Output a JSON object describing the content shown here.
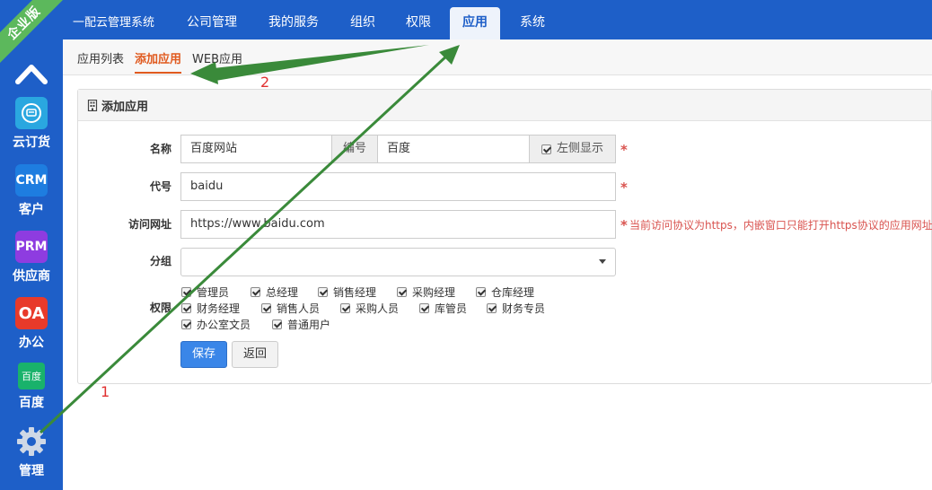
{
  "sidebar": {
    "ribbon": "企业版",
    "items": [
      {
        "label": "云订货",
        "tile_text": "",
        "color": "#2aa7e0"
      },
      {
        "label": "客户",
        "tile_text": "CRM",
        "color": "#1e7de0"
      },
      {
        "label": "供应商",
        "tile_text": "PRM",
        "color": "#8e3ce0"
      },
      {
        "label": "办公",
        "tile_text": "OA",
        "color": "#e83a2a"
      },
      {
        "label": "百度",
        "tile_text": "百度",
        "color": "#19b26b"
      },
      {
        "label": "管理",
        "tile_text": "",
        "color": "#1e5fc8"
      }
    ]
  },
  "topnav": {
    "brand": "一配云管理系统",
    "items": [
      "公司管理",
      "我的服务",
      "组织",
      "权限",
      "应用",
      "系统"
    ],
    "active": "应用"
  },
  "subtabs": [
    "应用列表",
    "添加应用",
    "WEB应用"
  ],
  "panel": {
    "title": "添加应用",
    "name_label": "名称",
    "name_value": "百度网站",
    "number_label": "编号",
    "number_value": "百度",
    "left_show_label": "左侧显示",
    "code_label": "代号",
    "code_value": "baidu",
    "url_label": "访问网址",
    "url_value": "https://www.baidu.com",
    "url_hint": "当前访问协议为https，内嵌窗口只能打开https协议的应用网址。",
    "group_label": "分组",
    "group_value": "",
    "perm_label": "权限",
    "permissions": [
      "管理员",
      "总经理",
      "销售经理",
      "采购经理",
      "仓库经理",
      "财务经理",
      "销售人员",
      "采购人员",
      "库管员",
      "财务专员",
      "办公室文员",
      "普通用户"
    ],
    "save_label": "保存",
    "back_label": "返回",
    "required_mark": "*"
  },
  "annotations": {
    "one": "1",
    "two": "2"
  },
  "colors": {
    "brand_blue": "#1e5fc8",
    "accent_orange": "#e05a1f",
    "arrow_green": "#3a8a3a",
    "required_red": "#d9534f"
  }
}
